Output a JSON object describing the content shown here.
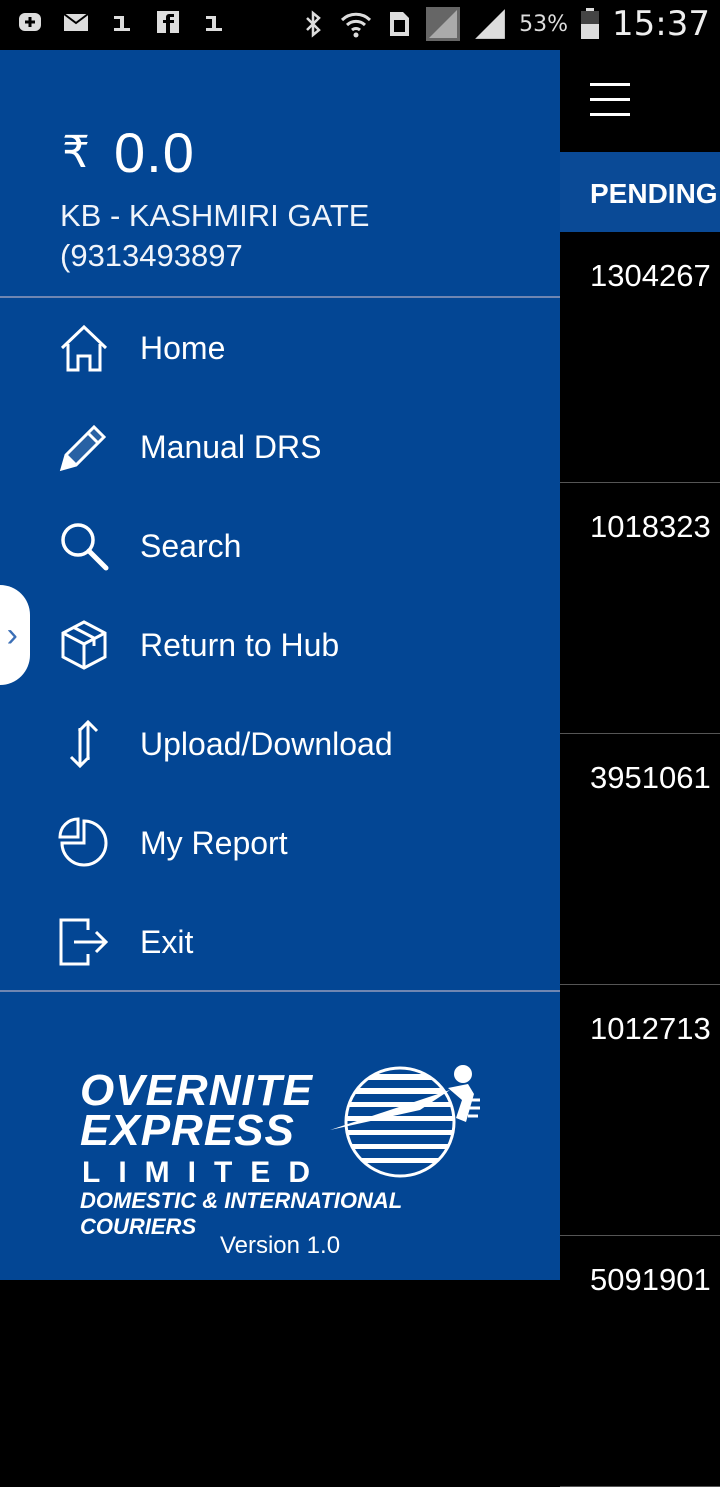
{
  "status_bar": {
    "battery_percent": "53%",
    "time": "15:37",
    "icons": [
      "add-notification-icon",
      "mail-icon",
      "one-icon",
      "facebook-icon",
      "one-icon",
      "bluetooth-icon",
      "wifi-icon",
      "sim-icon",
      "signal-icon",
      "signal-full-icon",
      "battery-icon"
    ]
  },
  "drawer": {
    "currency_symbol": "₹",
    "balance": "0.0",
    "branch": "KB - KASHMIRI GATE (9313493897",
    "menu": [
      {
        "label": "Home",
        "icon": "home-icon"
      },
      {
        "label": "Manual DRS",
        "icon": "pencil-icon"
      },
      {
        "label": "Search",
        "icon": "search-icon"
      },
      {
        "label": "Return to Hub",
        "icon": "box-icon"
      },
      {
        "label": "Upload/Download",
        "icon": "up-down-arrows-icon"
      },
      {
        "label": "My Report",
        "icon": "pie-chart-icon"
      },
      {
        "label": "Exit",
        "icon": "exit-icon"
      }
    ],
    "logo": {
      "line1": "OVERNITE",
      "line2": "EXPRESS",
      "line3": "LIMITED",
      "line4": "DOMESTIC & INTERNATIONAL COURIERS"
    },
    "version": "Version 1.0"
  },
  "background_app": {
    "tab_label": "PENDING",
    "rows": [
      "1304267",
      "1018323",
      "3951061",
      "1012713",
      "5091901"
    ]
  },
  "colors": {
    "drawer_bg": "#034694",
    "tab_bg": "#0a4a96",
    "divider": "#6f86b2"
  }
}
